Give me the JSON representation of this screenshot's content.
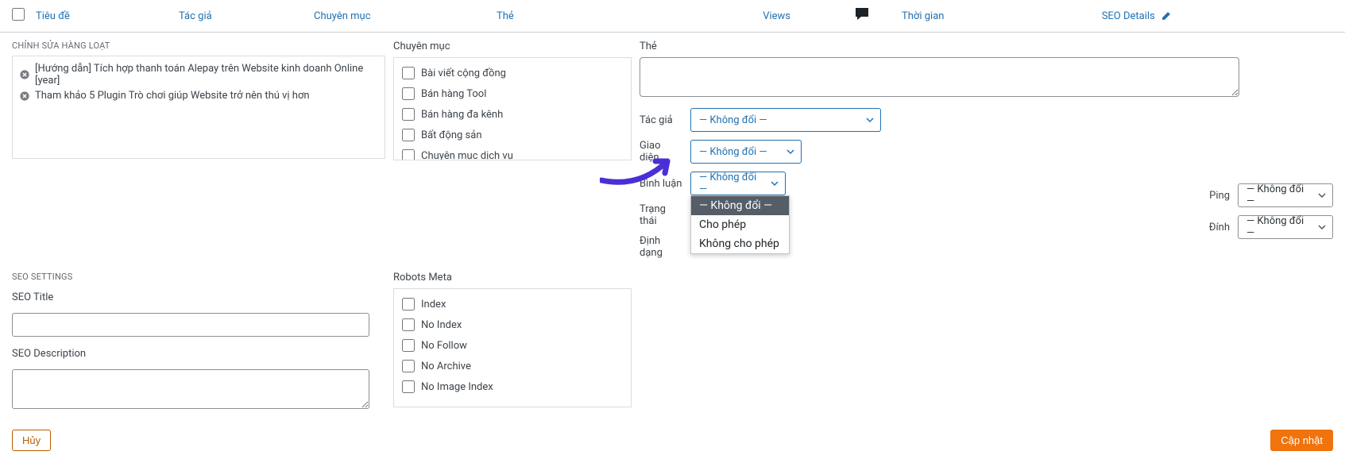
{
  "header": {
    "title": "Tiêu đề",
    "author": "Tác giả",
    "category": "Chuyên mục",
    "tag": "Thẻ",
    "views": "Views",
    "time": "Thời gian",
    "seo_details": "SEO Details"
  },
  "bulk": {
    "title": "CHỈNH SỬA HÀNG LOẠT",
    "items": [
      "[Hướng dẫn] Tích hợp thanh toán Alepay trên Website kinh doanh Online [year]",
      "Tham khảo 5 Plugin Trò chơi giúp Website trở nên thú vị hơn"
    ]
  },
  "categories": {
    "label": "Chuyên mục",
    "options": [
      "Bài viết cộng đồng",
      "Bán hàng Tool",
      "Bán hàng đa kênh",
      "Bất động sản",
      "Chuyên mục dịch vụ"
    ]
  },
  "tags": {
    "label": "Thẻ"
  },
  "fields": {
    "author": {
      "label": "Tác giả",
      "value": "— Không đổi —"
    },
    "template": {
      "label": "Giao diện",
      "value": "— Không đổi —"
    },
    "comments": {
      "label": "Bình luận",
      "value": "— Không đổi —",
      "options": [
        "— Không đổi —",
        "Cho phép",
        "Không cho phép"
      ]
    },
    "status": {
      "label": "Trạng thái"
    },
    "format": {
      "label": "Định dạng"
    },
    "ping": {
      "label": "Ping",
      "value": "— Không đổi —"
    },
    "sticky": {
      "label": "Đính",
      "value": "— Không đổi —"
    }
  },
  "seo": {
    "heading": "SEO SETTINGS",
    "title_label": "SEO Title",
    "desc_label": "SEO Description"
  },
  "robots": {
    "label": "Robots Meta",
    "options": [
      "Index",
      "No Index",
      "No Follow",
      "No Archive",
      "No Image Index"
    ]
  },
  "footer": {
    "cancel": "Hủy",
    "update": "Cập nhật"
  }
}
